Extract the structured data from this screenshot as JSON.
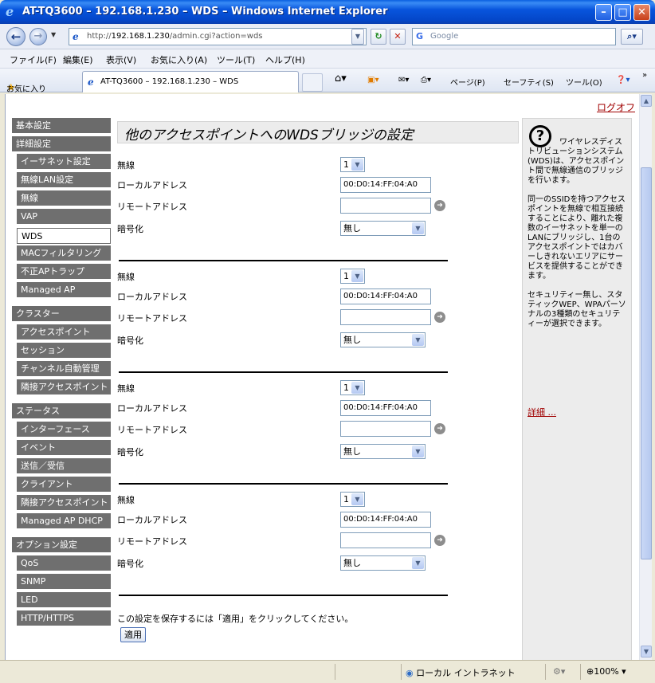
{
  "window": {
    "title": "AT-TQ3600 – 192.168.1.230 – WDS – Windows Internet Explorer"
  },
  "address": {
    "url_prefix": "http://",
    "url_host": "192.168.1.230",
    "url_path": "/admin.cgi?action=wds",
    "search_placeholder": "Google"
  },
  "menu": [
    "ファイル(F)",
    "編集(E)",
    "表示(V)",
    "お気に入り(A)",
    "ツール(T)",
    "ヘルプ(H)"
  ],
  "favorites": {
    "label": "お気に入り",
    "tab_title": "AT-TQ3600 – 192.168.1.230 – WDS",
    "commands": [
      "ページ(P)",
      "セーフティ(S)",
      "ツール(O)"
    ]
  },
  "page": {
    "logout": "ログオフ",
    "heading": "他のアクセスポイントへのWDSブリッジの設定",
    "save_hint": "この設定を保存するには「適用」をクリックしてください。",
    "apply_label": "適用"
  },
  "sidebar": {
    "items": [
      {
        "label": "基本設定",
        "kind": "section"
      },
      {
        "label": "詳細設定",
        "kind": "section"
      },
      {
        "label": "イーサネット設定",
        "kind": "sub"
      },
      {
        "label": "無線LAN設定",
        "kind": "sub"
      },
      {
        "label": "無線",
        "kind": "sub"
      },
      {
        "label": "VAP",
        "kind": "sub"
      },
      {
        "label": "WDS",
        "kind": "sub",
        "active": true
      },
      {
        "label": "MACフィルタリング",
        "kind": "sub"
      },
      {
        "label": "不正APトラップ",
        "kind": "sub"
      },
      {
        "label": "Managed AP",
        "kind": "sub"
      },
      {
        "label": "クラスター",
        "kind": "section"
      },
      {
        "label": "アクセスポイント",
        "kind": "sub"
      },
      {
        "label": "セッション",
        "kind": "sub"
      },
      {
        "label": "チャンネル自動管理",
        "kind": "sub"
      },
      {
        "label": "隣接アクセスポイント",
        "kind": "sub"
      },
      {
        "label": "ステータス",
        "kind": "section"
      },
      {
        "label": "インターフェース",
        "kind": "sub"
      },
      {
        "label": "イベント",
        "kind": "sub"
      },
      {
        "label": "送信／受信",
        "kind": "sub"
      },
      {
        "label": "クライアント",
        "kind": "sub"
      },
      {
        "label": "隣接アクセスポイント",
        "kind": "sub"
      },
      {
        "label": "Managed AP DHCP",
        "kind": "sub"
      },
      {
        "label": "オプション設定",
        "kind": "section"
      },
      {
        "label": "QoS",
        "kind": "sub"
      },
      {
        "label": "SNMP",
        "kind": "sub"
      },
      {
        "label": "LED",
        "kind": "sub"
      },
      {
        "label": "HTTP/HTTPS",
        "kind": "sub"
      }
    ]
  },
  "wds_form": {
    "labels": {
      "radio": "無線",
      "local_address": "ローカルアドレス",
      "remote_address": "リモートアドレス",
      "encryption": "暗号化"
    },
    "entries": [
      {
        "radio": "1",
        "local_address": "00:D0:14:FF:04:A0",
        "remote_address": "",
        "encryption": "無し"
      },
      {
        "radio": "1",
        "local_address": "00:D0:14:FF:04:A0",
        "remote_address": "",
        "encryption": "無し"
      },
      {
        "radio": "1",
        "local_address": "00:D0:14:FF:04:A0",
        "remote_address": "",
        "encryption": "無し"
      },
      {
        "radio": "1",
        "local_address": "00:D0:14:FF:04:A0",
        "remote_address": "",
        "encryption": "無し"
      }
    ]
  },
  "help": {
    "p1": "ワイヤレスディストリビューションシステム(WDS)は、アクセスポイント間で無線通信のブリッジを行います。",
    "p2": "同一のSSIDを持つアクセスポイントを無線で相互接続することにより、離れた複数のイーサネットを単一のLANにブリッジし、1台のアクセスポイントではカバーしきれないエリアにサービスを提供することができます。",
    "p3": "セキュリティー無し、スタティックWEP、WPAパーソナルの3種類のセキュリティーが選択できます。",
    "more_link": "詳細 ..."
  },
  "status": {
    "zone": "ローカル イントラネット",
    "zoom": "100%"
  },
  "colors": {
    "nav_bg": "#6f6f6f",
    "help_bg": "#ececec",
    "link": "#a00000",
    "titlebar": "#0855dd"
  }
}
